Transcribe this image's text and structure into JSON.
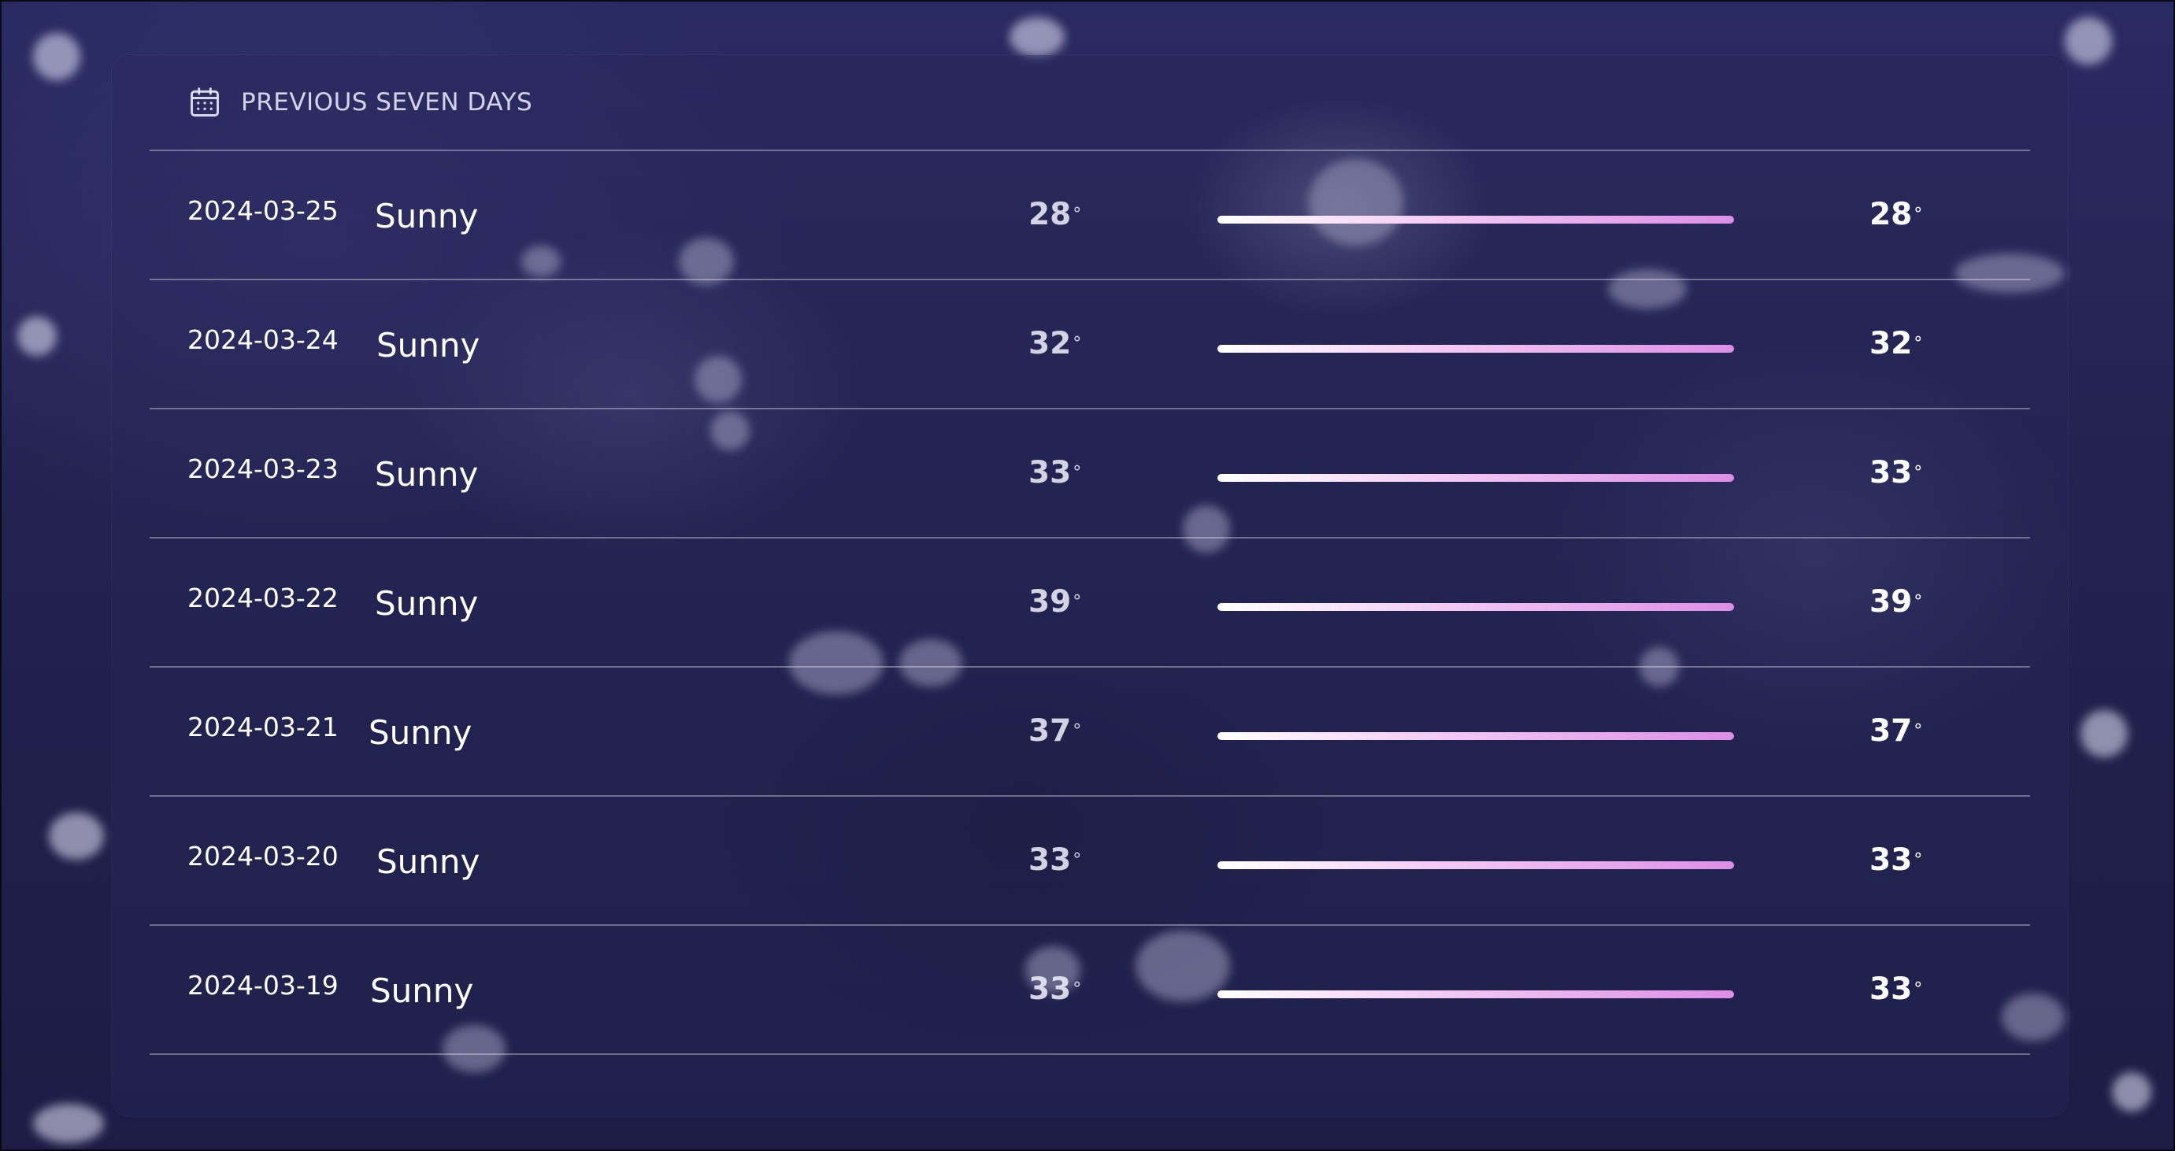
{
  "header": {
    "title": "PREVIOUS SEVEN DAYS",
    "icon": "calendar-icon"
  },
  "colors": {
    "bar_start": "#ffffff",
    "bar_end": "#dc8ee6",
    "text": "#ffffff"
  },
  "days": [
    {
      "date": "2024-03-25",
      "condition": "Sunny",
      "low": "28",
      "high": "28",
      "deg": "°"
    },
    {
      "date": "2024-03-24",
      "condition": "Sunny",
      "low": "32",
      "high": "32",
      "deg": "°"
    },
    {
      "date": "2024-03-23",
      "condition": "Sunny",
      "low": "33",
      "high": "33",
      "deg": "°"
    },
    {
      "date": "2024-03-22",
      "condition": "Sunny",
      "low": "39",
      "high": "39",
      "deg": "°"
    },
    {
      "date": "2024-03-21",
      "condition": "Sunny",
      "low": "37",
      "high": "37",
      "deg": "°"
    },
    {
      "date": "2024-03-20",
      "condition": "Sunny",
      "low": "33",
      "high": "33",
      "deg": "°"
    },
    {
      "date": "2024-03-19",
      "condition": "Sunny",
      "low": "33",
      "high": "33",
      "deg": "°"
    }
  ]
}
